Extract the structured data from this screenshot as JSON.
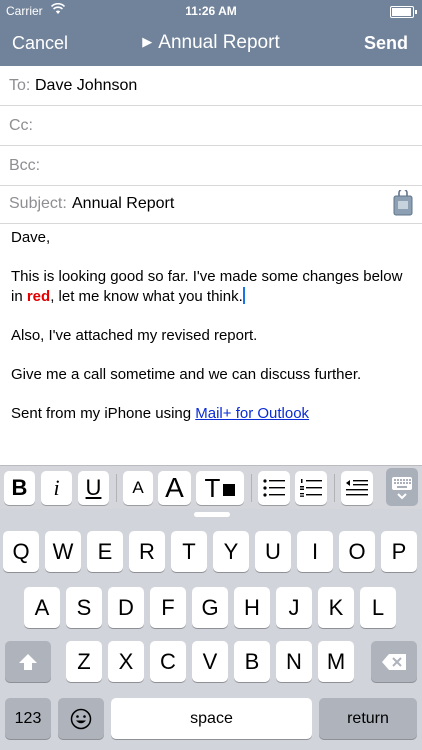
{
  "status": {
    "carrier": "Carrier",
    "time": "11:26 AM"
  },
  "nav": {
    "cancel": "Cancel",
    "title": "Annual Report",
    "send": "Send"
  },
  "fields": {
    "to_label": "To:",
    "to_value": "Dave Johnson",
    "cc_label": "Cc:",
    "bcc_label": "Bcc:",
    "subject_label": "Subject:",
    "subject_value": "Annual Report"
  },
  "body": {
    "greeting": "Dave,",
    "p1_before": "This is looking good so far. I've made some changes below in ",
    "p1_red": "red",
    "p1_after": ", let me know what you think.",
    "p2": "Also, I've attached my revised report.",
    "p3": "Give me a call sometime and we can discuss further.",
    "sig_prefix": "Sent from my iPhone using ",
    "sig_link": "Mail+ for Outlook"
  },
  "format_toolbar": {
    "bold": "B",
    "italic": "i",
    "underline": "U",
    "font_small": "A",
    "font_large": "A",
    "text_color": "T"
  },
  "keyboard": {
    "row1": [
      "Q",
      "W",
      "E",
      "R",
      "T",
      "Y",
      "U",
      "I",
      "O",
      "P"
    ],
    "row2": [
      "A",
      "S",
      "D",
      "F",
      "G",
      "H",
      "J",
      "K",
      "L"
    ],
    "row3": [
      "Z",
      "X",
      "C",
      "V",
      "B",
      "N",
      "M"
    ],
    "numbers": "123",
    "space": "space",
    "return": "return"
  },
  "colors": {
    "bar": "#71839a",
    "highlight": "#e20000",
    "link": "#0a2cd6"
  },
  "icons": [
    "wifi-icon",
    "battery-icon",
    "play-triangle-icon",
    "attachment-icon",
    "bullet-list-icon",
    "numbered-list-icon",
    "outdent-icon",
    "keyboard-hide-icon",
    "shift-icon",
    "backspace-icon",
    "emoji-icon"
  ]
}
